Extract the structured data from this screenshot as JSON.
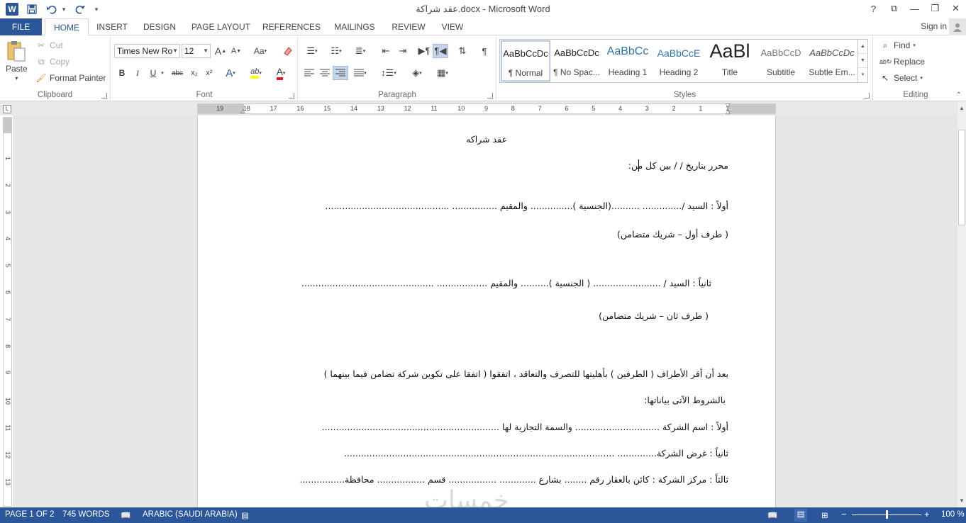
{
  "window": {
    "title": "عقد شراكة.docx - Microsoft Word",
    "help": "?",
    "restore_ribbon": "⧉",
    "minimize": "—",
    "maximize": "❐",
    "close": "✕"
  },
  "qat": {
    "app_icon": "W",
    "save_icon": "save-icon",
    "undo_icon": "undo-icon",
    "redo_icon": "redo-icon"
  },
  "tabs": [
    "FILE",
    "HOME",
    "INSERT",
    "DESIGN",
    "PAGE LAYOUT",
    "REFERENCES",
    "MAILINGS",
    "REVIEW",
    "VIEW"
  ],
  "signin": "Sign in",
  "clipboard": {
    "paste": "Paste",
    "cut": "Cut",
    "copy": "Copy",
    "format_painter": "Format Painter",
    "label": "Clipboard"
  },
  "font": {
    "name": "Times New Ro",
    "size": "12",
    "label": "Font",
    "bold": "B",
    "italic": "I",
    "underline": "U",
    "strike": "abc",
    "subscript": "x₂",
    "superscript": "x²",
    "grow": "A",
    "shrink": "A",
    "case": "Aa",
    "effects": "A",
    "highlight": "ab",
    "color": "A",
    "highlight_color": "#ffff00",
    "font_color": "#e81123"
  },
  "paragraph": {
    "label": "Paragraph",
    "show_marks": "¶"
  },
  "styles": {
    "label": "Styles",
    "items": [
      {
        "preview": "AaBbCcDc",
        "name": "¶ Normal"
      },
      {
        "preview": "AaBbCcDc",
        "name": "¶ No Spac..."
      },
      {
        "preview": "AaBbCc",
        "name": "Heading 1"
      },
      {
        "preview": "AaBbCcE",
        "name": "Heading 2"
      },
      {
        "preview": "AaBl",
        "name": "Title"
      },
      {
        "preview": "AaBbCcD",
        "name": "Subtitle"
      },
      {
        "preview": "AaBbCcDc",
        "name": "Subtle Em..."
      }
    ]
  },
  "editing": {
    "label": "Editing",
    "find": "Find",
    "replace": "Replace",
    "select": "Select"
  },
  "ruler": {
    "h_numbers": [
      "19",
      "18",
      "17",
      "16",
      "15",
      "14",
      "13",
      "12",
      "11",
      "10",
      "9",
      "8",
      "7",
      "6",
      "5",
      "4",
      "3",
      "2",
      "1",
      "1"
    ],
    "v_numbers": [
      "1",
      "2",
      "3",
      "4",
      "5",
      "6",
      "7",
      "8",
      "9",
      "10",
      "11",
      "12",
      "13"
    ]
  },
  "document": {
    "lines": [
      "عقد شراكه",
      "محرر بتاريخ /      /      بين كل من:",
      "أولاً : السيد /.............. ..........(الجنسية )............... والمقيم ................ ............................................",
      "( طرف أول – شريك متضامن)",
      "ثانياً : السيد / ........................ ( الجنسية ).......... والمقيم .................. ...............................................",
      "( طرف ثان – شريك متضامن)",
      "بعد أن أقر الأطراف ( الطرفين ) بأهليتها للتصرف والتعاقد ، اتفقوا ( اتفقا  على تكوين شركة تضامن فيما بينهما )",
      "بالشروط الآتى بياناتها:",
      "أولاً : اسم الشركة .............................. والسمة التجارية لها ...............................................................",
      "ثانياً : غرض الشركة.............. ................................................................................................",
      "ثالثاً : مركز الشركة : كائن بالعقار رقم ........ بشارع ............. ................. قسم ................. محافظة................"
    ]
  },
  "status": {
    "page": "PAGE 1 OF 2",
    "words": "745 WORDS",
    "language": "ARABIC (SAUDI ARABIA)",
    "zoom": "100 %",
    "zoom_level": 1.0
  },
  "watermark": "خمسات"
}
